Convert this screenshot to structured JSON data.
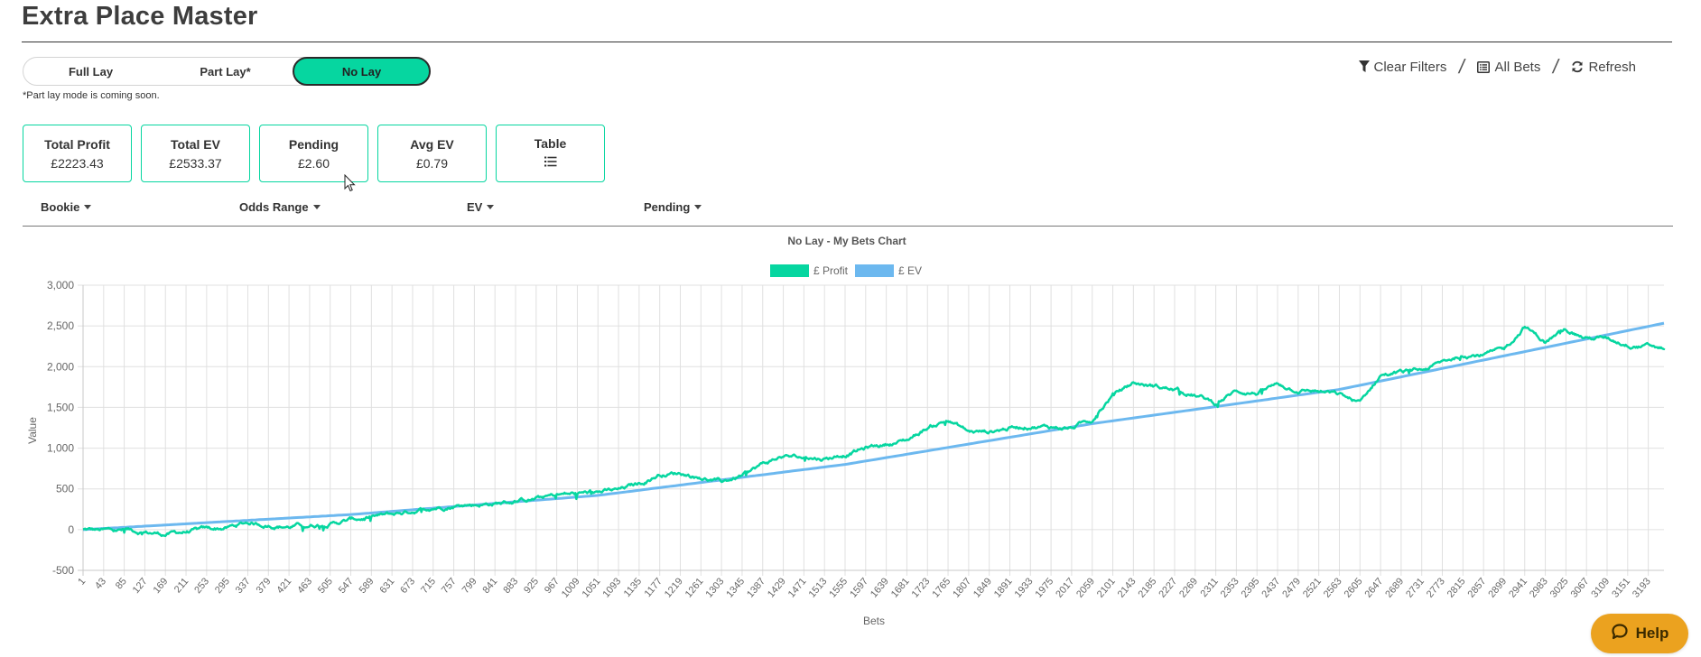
{
  "header": {
    "title": "Extra Place Master"
  },
  "modes": {
    "items": [
      {
        "label": "Full Lay",
        "active": false
      },
      {
        "label": "Part Lay*",
        "active": false
      },
      {
        "label": "No Lay",
        "active": true
      }
    ],
    "note": "*Part lay mode is coming soon."
  },
  "toolbar": {
    "clear_filters": "Clear Filters",
    "all_bets": "All Bets",
    "refresh": "Refresh",
    "separator": "/"
  },
  "cards": [
    {
      "label": "Total Profit",
      "value": "£2223.43"
    },
    {
      "label": "Total EV",
      "value": "£2533.37"
    },
    {
      "label": "Pending",
      "value": "£2.60"
    },
    {
      "label": "Avg EV",
      "value": "£0.79"
    },
    {
      "label": "Table",
      "icon": "list-icon"
    }
  ],
  "filters": [
    "Bookie",
    "Odds Range",
    "EV",
    "Pending"
  ],
  "colors": {
    "accent": "#06d6a0",
    "profit": "#06d6a0",
    "ev": "#6cb8ef",
    "help": "#eba21f"
  },
  "help": {
    "label": "Help"
  },
  "chart_data": {
    "type": "line",
    "title": "No Lay - My Bets Chart",
    "xlabel": "Bets",
    "ylabel": "Value",
    "ylim": [
      -500,
      3000
    ],
    "yticks": [
      -500,
      0,
      500,
      1000,
      1500,
      2000,
      2500,
      3000
    ],
    "xlim": [
      1,
      3225
    ],
    "xtick_start": 1,
    "xtick_step": 42,
    "xtick_end": 3193,
    "grid": true,
    "legend": "top-center",
    "series": [
      {
        "name": "£ Profit",
        "color": "#06d6a0",
        "final_value": 2223.43,
        "waypoints": [
          [
            1,
            0
          ],
          [
            43,
            -15
          ],
          [
            85,
            -10
          ],
          [
            127,
            -30
          ],
          [
            169,
            -55
          ],
          [
            211,
            -25
          ],
          [
            253,
            -5
          ],
          [
            295,
            20
          ],
          [
            337,
            85
          ],
          [
            379,
            60
          ],
          [
            421,
            40
          ],
          [
            463,
            60
          ],
          [
            505,
            80
          ],
          [
            547,
            120
          ],
          [
            589,
            150
          ],
          [
            631,
            180
          ],
          [
            673,
            230
          ],
          [
            715,
            280
          ],
          [
            757,
            300
          ],
          [
            799,
            310
          ],
          [
            841,
            320
          ],
          [
            883,
            350
          ],
          [
            925,
            380
          ],
          [
            967,
            420
          ],
          [
            1009,
            440
          ],
          [
            1051,
            460
          ],
          [
            1093,
            480
          ],
          [
            1135,
            560
          ],
          [
            1177,
            680
          ],
          [
            1219,
            700
          ],
          [
            1261,
            640
          ],
          [
            1303,
            580
          ],
          [
            1345,
            660
          ],
          [
            1387,
            800
          ],
          [
            1429,
            900
          ],
          [
            1471,
            880
          ],
          [
            1513,
            870
          ],
          [
            1555,
            930
          ],
          [
            1597,
            1000
          ],
          [
            1639,
            1050
          ],
          [
            1681,
            1100
          ],
          [
            1723,
            1250
          ],
          [
            1765,
            1350
          ],
          [
            1807,
            1200
          ],
          [
            1849,
            1200
          ],
          [
            1891,
            1250
          ],
          [
            1933,
            1280
          ],
          [
            1975,
            1260
          ],
          [
            2017,
            1250
          ],
          [
            2059,
            1350
          ],
          [
            2101,
            1650
          ],
          [
            2143,
            1800
          ],
          [
            2185,
            1760
          ],
          [
            2227,
            1720
          ],
          [
            2269,
            1650
          ],
          [
            2311,
            1550
          ],
          [
            2353,
            1700
          ],
          [
            2395,
            1680
          ],
          [
            2437,
            1780
          ],
          [
            2479,
            1720
          ],
          [
            2521,
            1700
          ],
          [
            2563,
            1650
          ],
          [
            2605,
            1550
          ],
          [
            2647,
            1900
          ],
          [
            2689,
            1930
          ],
          [
            2731,
            1950
          ],
          [
            2773,
            2050
          ],
          [
            2815,
            2150
          ],
          [
            2857,
            2150
          ],
          [
            2899,
            2200
          ],
          [
            2941,
            2500
          ],
          [
            2983,
            2300
          ],
          [
            3025,
            2450
          ],
          [
            3067,
            2350
          ],
          [
            3109,
            2350
          ],
          [
            3151,
            2280
          ],
          [
            3193,
            2250
          ],
          [
            3225,
            2223.43
          ]
        ]
      },
      {
        "name": "£ EV",
        "color": "#6cb8ef",
        "final_value": 2533.37,
        "waypoints": [
          [
            1,
            0
          ],
          [
            547,
            185
          ],
          [
            1051,
            420
          ],
          [
            1555,
            800
          ],
          [
            2059,
            1300
          ],
          [
            2563,
            1720
          ],
          [
            3225,
            2533.37
          ]
        ]
      }
    ]
  }
}
